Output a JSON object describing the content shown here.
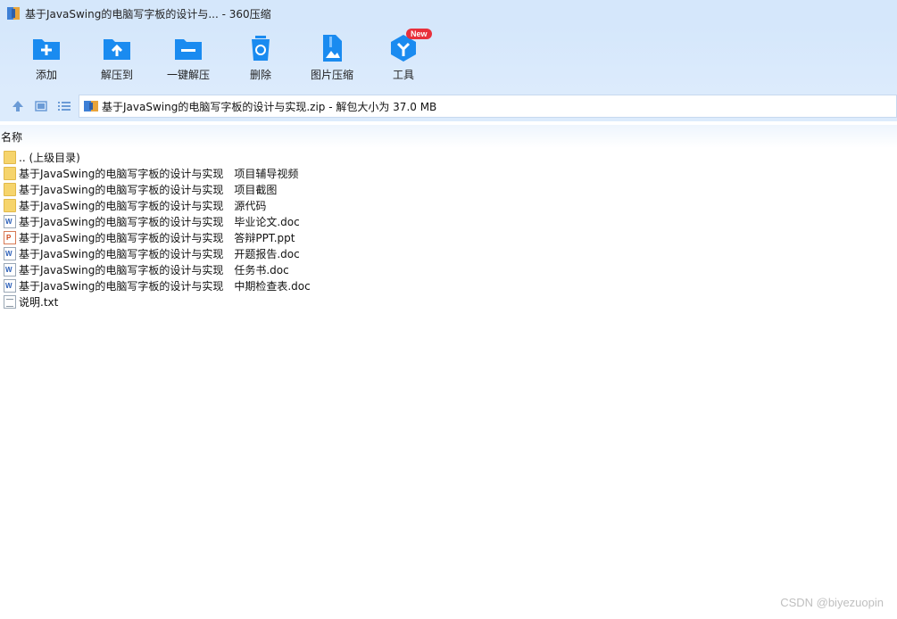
{
  "window": {
    "title": "基于JavaSwing的电脑写字板的设计与... - 360压缩"
  },
  "toolbar": {
    "items": [
      {
        "label": "添加",
        "icon": "add-icon"
      },
      {
        "label": "解压到",
        "icon": "extract-to-icon"
      },
      {
        "label": "一键解压",
        "icon": "one-click-extract-icon"
      },
      {
        "label": "删除",
        "icon": "delete-icon"
      },
      {
        "label": "图片压缩",
        "icon": "image-compress-icon"
      },
      {
        "label": "工具",
        "icon": "tools-icon",
        "badge": "New"
      }
    ],
    "accent_color": "#1a8bf0",
    "badge_color": "#e8303b"
  },
  "path_bar": {
    "text": "基于JavaSwing的电脑写字板的设计与实现.zip - 解包大小为 37.0 MB"
  },
  "list": {
    "column_name": "名称",
    "items": [
      {
        "name": ".. (上级目录)",
        "type": "folder"
      },
      {
        "name": "基于JavaSwing的电脑写字板的设计与实现　项目辅导视频",
        "type": "folder"
      },
      {
        "name": "基于JavaSwing的电脑写字板的设计与实现　项目截图",
        "type": "folder"
      },
      {
        "name": "基于JavaSwing的电脑写字板的设计与实现　源代码",
        "type": "folder"
      },
      {
        "name": "基于JavaSwing的电脑写字板的设计与实现　毕业论文.doc",
        "type": "doc"
      },
      {
        "name": "基于JavaSwing的电脑写字板的设计与实现　答辩PPT.ppt",
        "type": "ppt"
      },
      {
        "name": "基于JavaSwing的电脑写字板的设计与实现　开题报告.doc",
        "type": "doc"
      },
      {
        "name": "基于JavaSwing的电脑写字板的设计与实现　任务书.doc",
        "type": "doc"
      },
      {
        "name": "基于JavaSwing的电脑写字板的设计与实现　中期检查表.doc",
        "type": "doc"
      },
      {
        "name": "说明.txt",
        "type": "txt"
      }
    ]
  },
  "watermark": "CSDN @biyezuopin"
}
